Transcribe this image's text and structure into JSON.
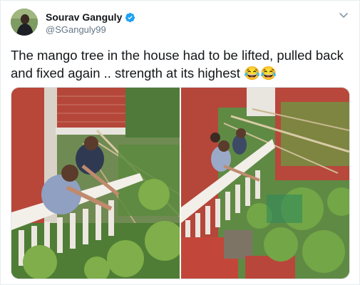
{
  "tweet": {
    "display_name": "Sourav Ganguly",
    "handle": "@SGanguly99",
    "text": "The mango tree in the house had to be lifted, pulled back and fixed again .. strength at its highest 😂😂",
    "verified": true
  },
  "icons": {
    "verified": "verified-badge-icon",
    "menu": "chevron-down-icon"
  },
  "colors": {
    "verified_blue": "#1da1f2",
    "text": "#14171a",
    "secondary_text": "#657786"
  }
}
